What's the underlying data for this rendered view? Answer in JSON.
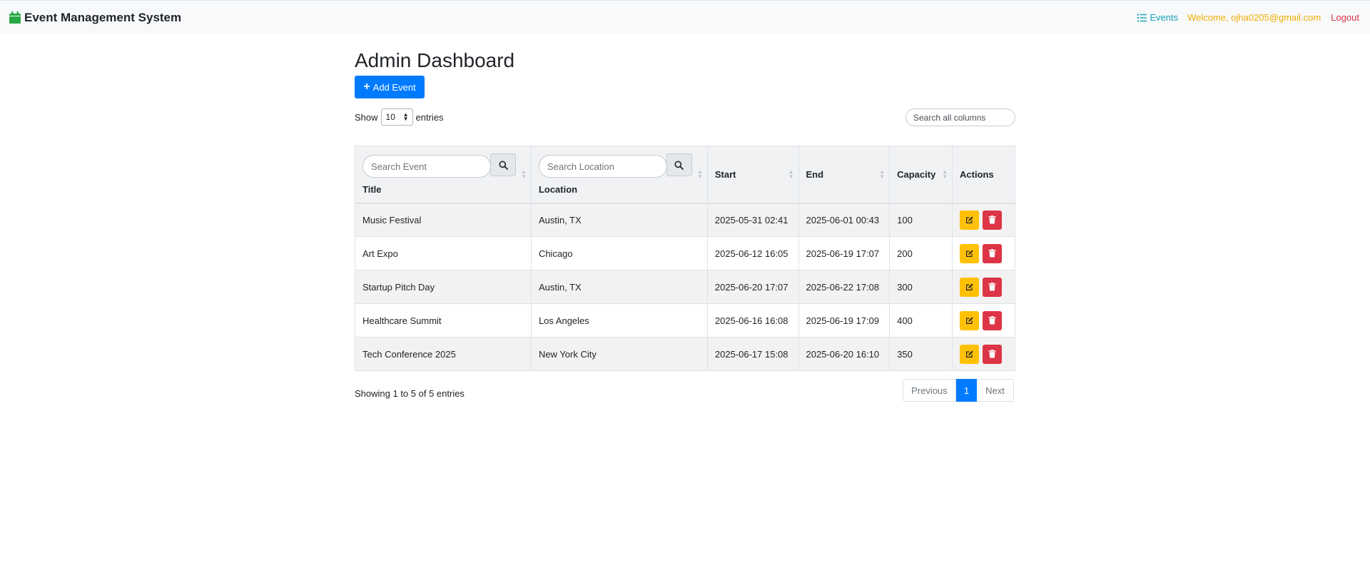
{
  "navbar": {
    "brand": "Event Management System",
    "events_link": "Events",
    "welcome": "Welcome, ojha0205@gmail.com",
    "logout": "Logout"
  },
  "page": {
    "title": "Admin Dashboard",
    "add_button": "Add Event"
  },
  "controls": {
    "show_label": "Show",
    "entries_label": "entries",
    "page_length": "10",
    "global_search_placeholder": "Search all columns"
  },
  "table": {
    "columns": [
      "Title",
      "Location",
      "Start",
      "End",
      "Capacity",
      "Actions"
    ],
    "title_search_placeholder": "Search Event",
    "location_search_placeholder": "Search Location",
    "rows": [
      {
        "title": "Music Festival",
        "location": "Austin, TX",
        "start": "2025-05-31 02:41",
        "end": "2025-06-01 00:43",
        "capacity": "100"
      },
      {
        "title": "Art Expo",
        "location": "Chicago",
        "start": "2025-06-12 16:05",
        "end": "2025-06-19 17:07",
        "capacity": "200"
      },
      {
        "title": "Startup Pitch Day",
        "location": "Austin, TX",
        "start": "2025-06-20 17:07",
        "end": "2025-06-22 17:08",
        "capacity": "300"
      },
      {
        "title": "Healthcare Summit",
        "location": "Los Angeles",
        "start": "2025-06-16 16:08",
        "end": "2025-06-19 17:09",
        "capacity": "400"
      },
      {
        "title": "Tech Conference 2025",
        "location": "New York City",
        "start": "2025-06-17 15:08",
        "end": "2025-06-20 16:10",
        "capacity": "350"
      }
    ]
  },
  "footer": {
    "info": "Showing 1 to 5 of 5 entries",
    "previous": "Previous",
    "current_page": "1",
    "next": "Next"
  },
  "colors": {
    "primary": "#007bff",
    "brand_icon": "#28a745",
    "events_link": "#17a2b8",
    "welcome": "#f0ad00",
    "logout": "#dc3545",
    "edit": "#ffc107",
    "delete": "#dc3545"
  },
  "icons": {
    "brand": "calendar-icon",
    "events": "list-icon",
    "add": "plus-icon",
    "search": "search-icon",
    "edit": "edit-icon",
    "delete": "trash-icon"
  }
}
